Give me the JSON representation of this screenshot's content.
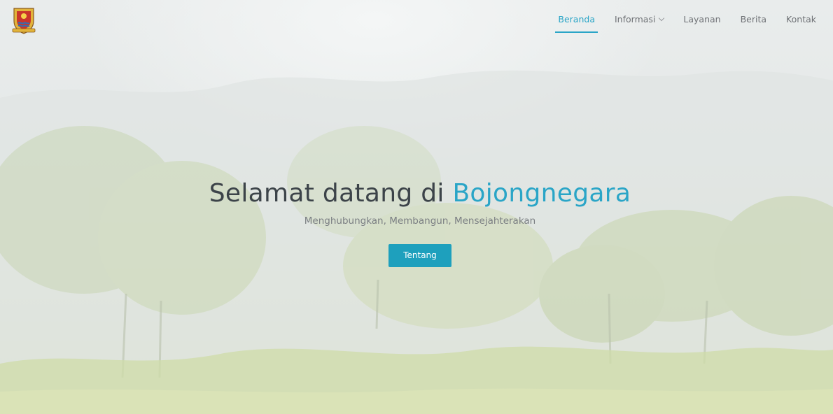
{
  "header": {
    "logo_icon": "regency-crest-icon",
    "nav": {
      "home": "Beranda",
      "info": "Informasi",
      "services": "Layanan",
      "news": "Berita",
      "contact": "Kontak"
    }
  },
  "hero": {
    "title_prefix": "Selamat datang di",
    "title_highlight": "Bojongnegara",
    "subtitle": "Menghubungkan, Membangun, Mensejahterakan",
    "cta_label": "Tentang"
  },
  "colors": {
    "accent": "#2aa5c7",
    "button": "#1ea0bd",
    "title": "#3c4349",
    "nav_text": "#6f7276"
  }
}
